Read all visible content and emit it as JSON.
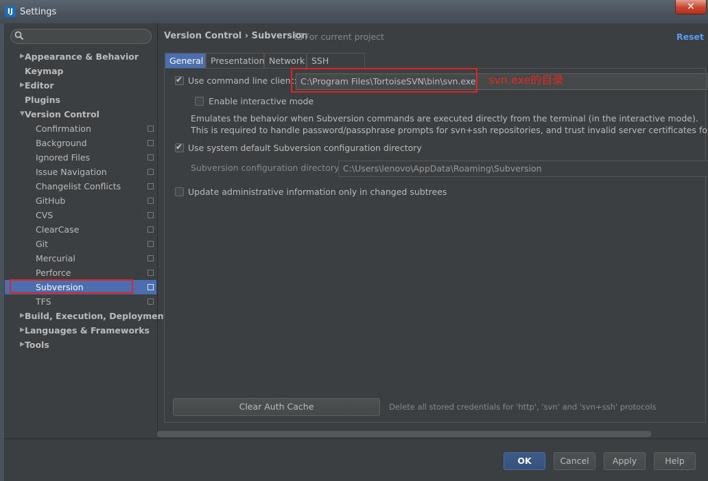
{
  "window": {
    "title": "Settings",
    "app_icon": "IJ"
  },
  "search": {
    "placeholder": ""
  },
  "sidebar": {
    "items": [
      {
        "label": "Appearance & Behavior"
      },
      {
        "label": "Keymap"
      },
      {
        "label": "Editor"
      },
      {
        "label": "Plugins"
      },
      {
        "label": "Version Control"
      },
      {
        "label": "Confirmation"
      },
      {
        "label": "Background"
      },
      {
        "label": "Ignored Files"
      },
      {
        "label": "Issue Navigation"
      },
      {
        "label": "Changelist Conflicts"
      },
      {
        "label": "GitHub"
      },
      {
        "label": "CVS"
      },
      {
        "label": "ClearCase"
      },
      {
        "label": "Git"
      },
      {
        "label": "Mercurial"
      },
      {
        "label": "Perforce"
      },
      {
        "label": "Subversion"
      },
      {
        "label": "TFS"
      },
      {
        "label": "Build, Execution, Deployment"
      },
      {
        "label": "Languages & Frameworks"
      },
      {
        "label": "Tools"
      }
    ]
  },
  "header": {
    "breadcrumb_parent": "Version Control",
    "breadcrumb_sep": "›",
    "breadcrumb_current": "Subversion",
    "scope": "For current project",
    "reset": "Reset"
  },
  "tabs": [
    {
      "label": "General"
    },
    {
      "label": "Presentation"
    },
    {
      "label": "Network"
    },
    {
      "label": "SSH Settings"
    }
  ],
  "general": {
    "use_cmd_client_label": "Use command line client:",
    "cmd_client_value": "C:\\Program Files\\TortoiseSVN\\bin\\svn.exe",
    "annotation": "svn.exe的目录",
    "interactive_label": "Enable interactive mode",
    "desc_line1": "Emulates the behavior when Subversion commands are executed directly from the terminal (in the interactive mode).",
    "desc_line2": "This is required to handle password/passphrase prompts for svn+ssh repositories, and trust invalid server certificates for https r",
    "use_default_dir_label": "Use system default Subversion configuration directory",
    "config_dir_label": "Subversion configuration directory:",
    "config_dir_value": "C:\\Users\\lenovo\\AppData\\Roaming\\Subversion",
    "update_admin_label": "Update administrative information only in changed subtrees",
    "clear_cache": "Clear Auth Cache",
    "clear_cache_note": "Delete all stored credentials for 'http', 'svn' and 'svn+ssh' protocols",
    "use_cmd_client_checked": true,
    "interactive_checked": false,
    "use_default_dir_checked": true,
    "update_admin_checked": false
  },
  "footer": {
    "ok": "OK",
    "cancel": "Cancel",
    "apply": "Apply",
    "help": "Help"
  },
  "colors": {
    "selection": "#4b6eaf",
    "annotation_red": "#e0251e",
    "link_blue": "#589df6",
    "background": "#3c3f41"
  }
}
